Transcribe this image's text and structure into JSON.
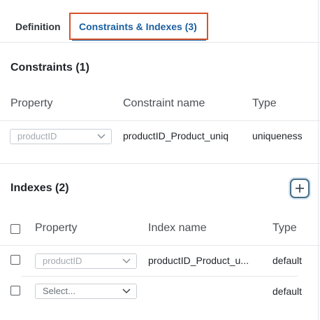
{
  "tabs": {
    "definition": "Definition",
    "constraints_indexes": "Constraints & Indexes (3)"
  },
  "constraints": {
    "title": "Constraints (1)",
    "columns": {
      "property": "Property",
      "name": "Constraint name",
      "type": "Type"
    },
    "rows": [
      {
        "property": "productID",
        "name": "productID_Product_uniq",
        "type": "uniqueness"
      }
    ]
  },
  "indexes": {
    "title": "Indexes (2)",
    "columns": {
      "property": "Property",
      "name": "Index name",
      "type": "Type"
    },
    "rows": [
      {
        "property": "productID",
        "name": "productID_Product_u...",
        "type": "default"
      },
      {
        "property": "Select...",
        "name": "",
        "type": "default"
      }
    ]
  },
  "colors": {
    "accent": "#1a5fa0",
    "highlight": "#d9532b"
  }
}
